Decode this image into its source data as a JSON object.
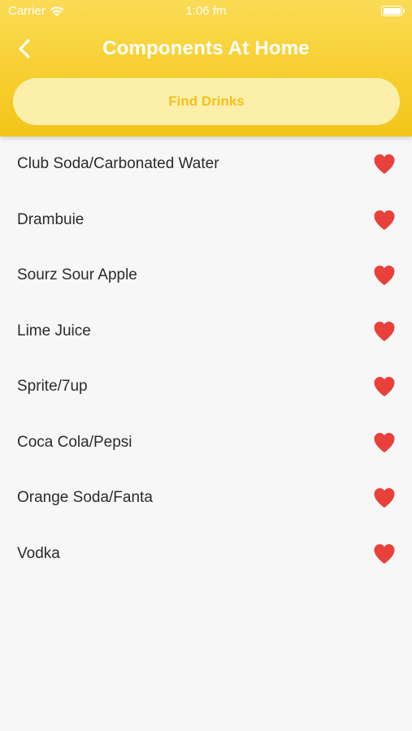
{
  "status_bar": {
    "carrier": "Carrier",
    "time": "1:06 fm"
  },
  "nav": {
    "title": "Components At Home",
    "back_icon": "chevron-left-icon"
  },
  "find_button": {
    "label": "Find Drinks"
  },
  "items": [
    {
      "label": "Club Soda/Carbonated Water",
      "favorite": true
    },
    {
      "label": "Drambuie",
      "favorite": true
    },
    {
      "label": "Sourz Sour Apple",
      "favorite": true
    },
    {
      "label": "Lime Juice",
      "favorite": true
    },
    {
      "label": "Sprite/7up",
      "favorite": true
    },
    {
      "label": "Coca Cola/Pepsi",
      "favorite": true
    },
    {
      "label": "Orange Soda/Fanta",
      "favorite": true
    },
    {
      "label": "Vodka",
      "favorite": true
    }
  ],
  "colors": {
    "header": "#f6ce2c",
    "button_bg": "#fcefaa",
    "button_text": "#f2c21d",
    "heart": "#e8413c"
  }
}
